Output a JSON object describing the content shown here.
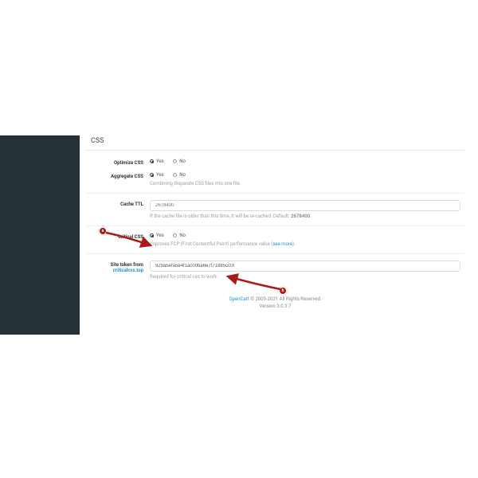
{
  "panel": {
    "legend": "CSS",
    "optimize": {
      "label": "Optimize CSS",
      "yes": "Yes",
      "no": "No"
    },
    "aggregate": {
      "label": "Aggregate CSS",
      "yes": "Yes",
      "no": "No",
      "help": "Combining disparate CSS files into one file."
    },
    "cache": {
      "label": "Cache TTL",
      "placeholder": "2678400",
      "help_pre": "If the cache file is older than this time, it will be re-cached. Default: ",
      "help_bold": "2678400",
      "help_post": "."
    },
    "critical": {
      "label": "Critical CSS",
      "yes": "Yes",
      "no": "No",
      "help_pre": "Improves FCP (First Contentful Paint) performance value (",
      "help_link": "see more",
      "help_post": ")."
    },
    "token": {
      "label_pre": "Site token from ",
      "label_link": "criticalcss.top",
      "value": "929a5efa5e4f1ac00ba6e7f71885cc0f",
      "help": "Required for critical css to work."
    }
  },
  "footer": {
    "brand": "OpenCart",
    "rights": " © 2009-2021 All Rights Reserved.",
    "version": "Version 3.0.3.7"
  },
  "anno": {
    "a": "a",
    "b": "b"
  }
}
